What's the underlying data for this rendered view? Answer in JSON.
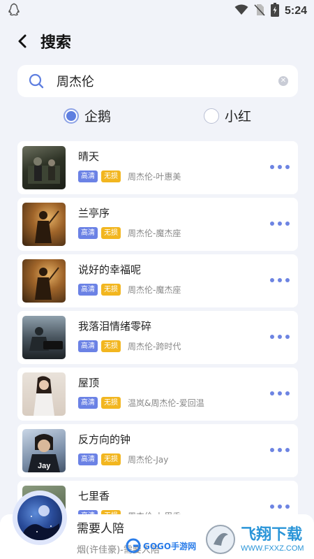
{
  "status_bar": {
    "time": "5:24"
  },
  "header": {
    "title": "搜索"
  },
  "search": {
    "value": "周杰伦"
  },
  "sources": [
    {
      "label": "企鹅",
      "selected": true
    },
    {
      "label": "小红",
      "selected": false
    }
  ],
  "tags": {
    "hq": "高清",
    "lossless": "无损"
  },
  "songs": [
    {
      "title": "晴天",
      "artist": "周杰伦-叶惠美"
    },
    {
      "title": "兰亭序",
      "artist": "周杰伦-魔杰座"
    },
    {
      "title": "说好的幸福呢",
      "artist": "周杰伦-魔杰座"
    },
    {
      "title": "我落泪情绪零碎",
      "artist": "周杰伦-跨时代"
    },
    {
      "title": "屋顶",
      "artist": "温岚&周杰伦-爱回温"
    },
    {
      "title": "反方向的钟",
      "artist": "周杰伦-Jay"
    },
    {
      "title": "七里香",
      "artist": "周杰伦-七里香"
    }
  ],
  "player": {
    "title": "需要人陪",
    "subtitle": "烟(许佳豪)-需要人陪"
  },
  "watermark": {
    "left_text": "GOGO手游网",
    "right_text": "飞翔下载",
    "url": "WWW.FXXZ.COM"
  },
  "colors": {
    "accent": "#5f7fe0",
    "tag_hq": "#6b82e5",
    "tag_lossless": "#f2b61f",
    "background": "#f1f3f9"
  }
}
